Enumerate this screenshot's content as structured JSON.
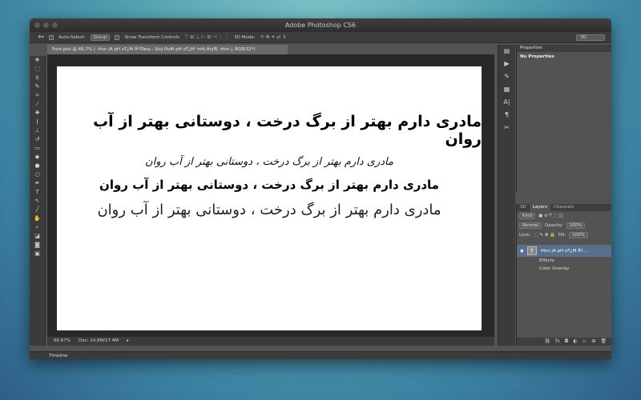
{
  "window": {
    "title": "Adobe Photoshop CS6"
  },
  "options_bar": {
    "auto_select_label": "Auto-Select:",
    "auto_select_value": "Group",
    "show_transform_label": "Show Transform Controls",
    "mode_3d_label": "3D Mode:",
    "workspace_value": "3D"
  },
  "document": {
    "tab_title": "Font.psd @ 66.7% ( -Hvn jA pH oT¿M Ä*ITwvj - Sinj ÐoM pH oT¿M ²nHj Ãnj¶|  -Hvn j, RGB/32*)",
    "lines": [
      "مادری دارم بهتر از برگ درخت ، دوستانی بهتر از آب روان",
      "مادری دارم بهتر از برگ درخت ، دوستانی بهتر از آب روان",
      "مادری دارم بهتر از برگ درخت ، دوستانی بهتر از آب روان",
      "مادری دارم بهتر از برگ درخت ، دوستانی بهتر از آب روان"
    ]
  },
  "status": {
    "zoom": "66.67%",
    "doc_size": "Doc: 14.8M/17.4M"
  },
  "timeline": {
    "label": "Timeline"
  },
  "properties_panel": {
    "tab": "Properties",
    "message": "No Properties"
  },
  "layers_panel": {
    "tabs": [
      "3D",
      "Layers",
      "Channels"
    ],
    "filter_kind": "Kind",
    "blend_mode": "Normal",
    "opacity_label": "Opacity:",
    "opacity_value": "100%",
    "lock_label": "Lock:",
    "fill_label": "Fill:",
    "fill_value": "100%",
    "layer_name": "-Hvn jA pH oT¿M Ä*...",
    "effects_label": "Effects",
    "color_overlay_label": "Color Overlay"
  },
  "icons": [
    "move-icon",
    "marquee-icon",
    "lasso-icon",
    "brush-icon",
    "type-icon",
    "hand-icon",
    "zoom-icon"
  ]
}
